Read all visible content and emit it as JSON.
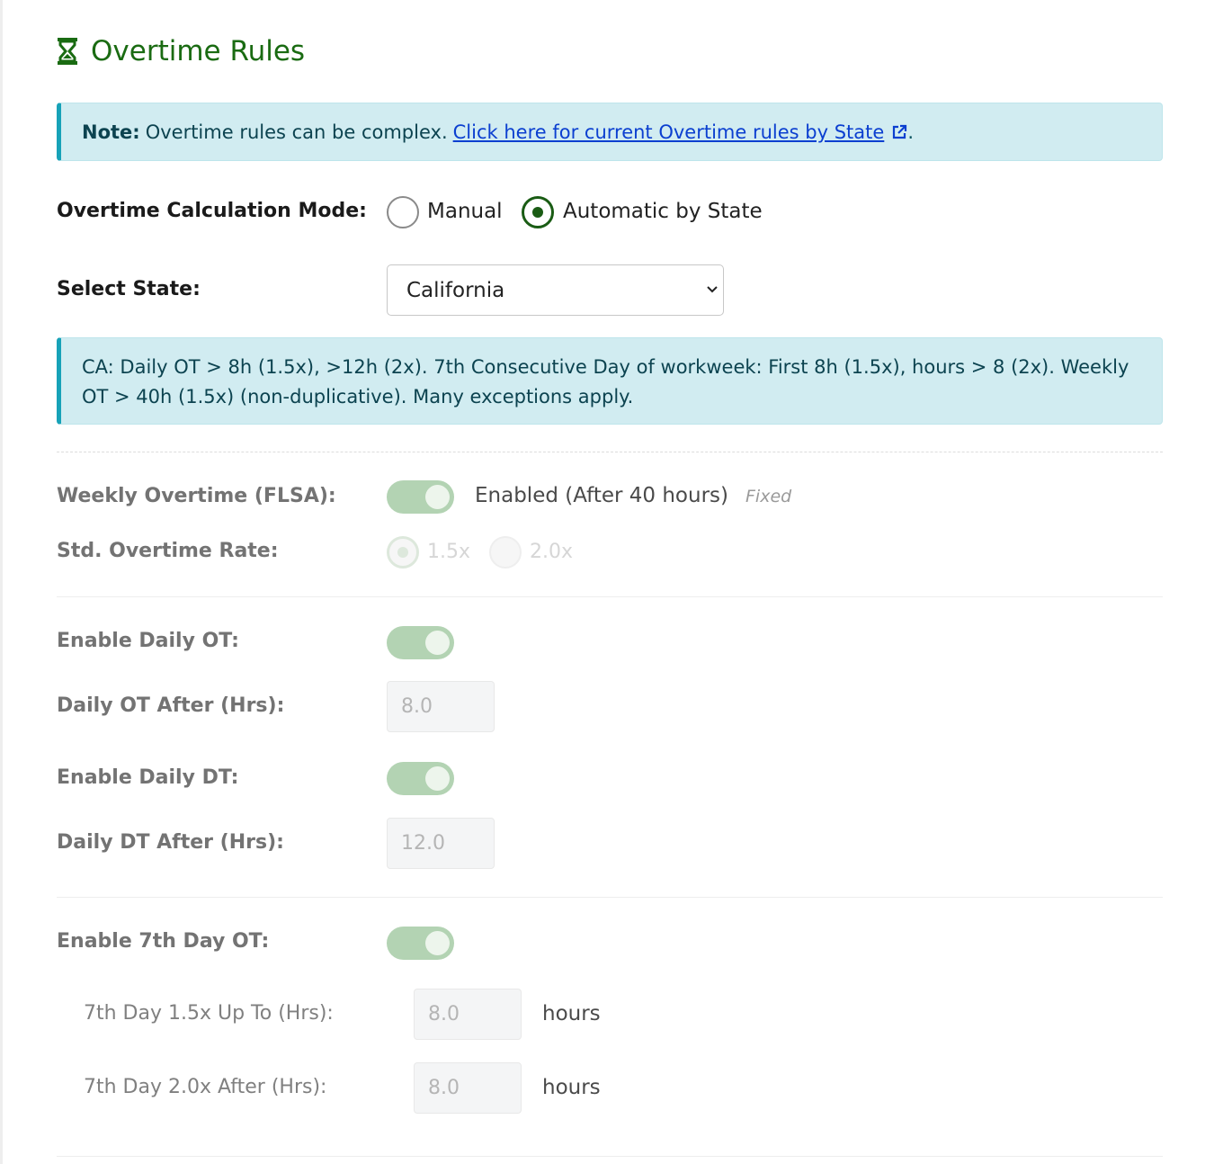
{
  "title": "Overtime Rules",
  "note": {
    "strong": "Note:",
    "text": "Overtime rules can be complex.",
    "link": "Click here for current Overtime rules by State",
    "trailing": "."
  },
  "mode": {
    "label": "Overtime Calculation Mode:",
    "options": [
      "Manual",
      "Automatic by State"
    ],
    "selected": "Automatic by State"
  },
  "state": {
    "label": "Select State:",
    "value": "California"
  },
  "info": "CA: Daily OT > 8h (1.5x), >12h (2x). 7th Consecutive Day of workweek: First 8h (1.5x), hours > 8 (2x). Weekly OT > 40h (1.5x) (non-duplicative). Many exceptions apply.",
  "weekly": {
    "label": "Weekly Overtime (FLSA):",
    "enabled": true,
    "status": "Enabled (After 40 hours)",
    "badge": "Fixed"
  },
  "std_rate": {
    "label": "Std. Overtime Rate:",
    "options": [
      "1.5x",
      "2.0x"
    ],
    "selected": "1.5x"
  },
  "daily_ot": {
    "label": "Enable Daily OT:",
    "enabled": true
  },
  "daily_ot_after": {
    "label": "Daily OT After (Hrs):",
    "value": "8.0"
  },
  "daily_dt": {
    "label": "Enable Daily DT:",
    "enabled": true
  },
  "daily_dt_after": {
    "label": "Daily DT After (Hrs):",
    "value": "12.0"
  },
  "seventh": {
    "label": "Enable 7th Day OT:",
    "enabled": true
  },
  "seventh_15": {
    "label": "7th Day 1.5x Up To (Hrs):",
    "value": "8.0",
    "unit": "hours"
  },
  "seventh_20": {
    "label": "7th Day 2.0x After (Hrs):",
    "value": "8.0",
    "unit": "hours"
  },
  "colors": {
    "title": "#1a6b12",
    "alert_bg": "#d1ecf1",
    "alert_border": "#17a2b8",
    "link": "#0b3fd0",
    "toggle_on_disabled": "#b3d3b3"
  }
}
